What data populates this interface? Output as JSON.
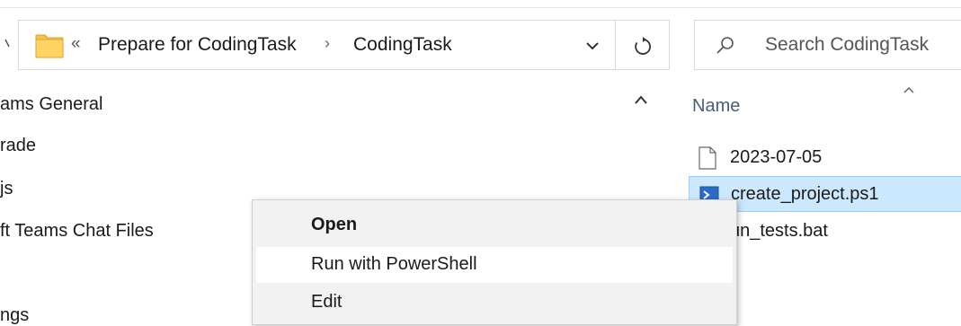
{
  "address_bar": {
    "overflow_glyph": "«",
    "crumbs": [
      "Prepare for CodingTask",
      "CodingTask"
    ],
    "separator": "›",
    "folder_icon": "folder-icon",
    "dropdown_icon": "chevron-down-icon"
  },
  "refresh": {
    "icon": "refresh-icon"
  },
  "search": {
    "placeholder": "Search CodingTask",
    "icon": "search-icon"
  },
  "nav_pane": {
    "items": [
      "ams General",
      "rade",
      "js",
      "ft Teams Chat Files",
      "ngs"
    ]
  },
  "file_list": {
    "column_name": "Name",
    "files": [
      {
        "name": "2023-07-05",
        "icon": "blank-file-icon",
        "selected": false
      },
      {
        "name": "create_project.ps1",
        "icon": "powershell-script-icon",
        "selected": true
      },
      {
        "name": "un_tests.bat",
        "icon": "batch-file-icon",
        "selected": false
      }
    ]
  },
  "context_menu": {
    "items": [
      {
        "label": "Open",
        "bold": true
      },
      {
        "label": "Run with PowerShell",
        "bold": false
      },
      {
        "label": "Edit",
        "bold": false
      }
    ]
  },
  "colors": {
    "selection_bg": "#cce8ff",
    "selection_border": "#99d1ff",
    "folder_yellow": "#f5c24b",
    "header_text": "#4a5d7a",
    "menu_bg": "#f2f2f2"
  }
}
